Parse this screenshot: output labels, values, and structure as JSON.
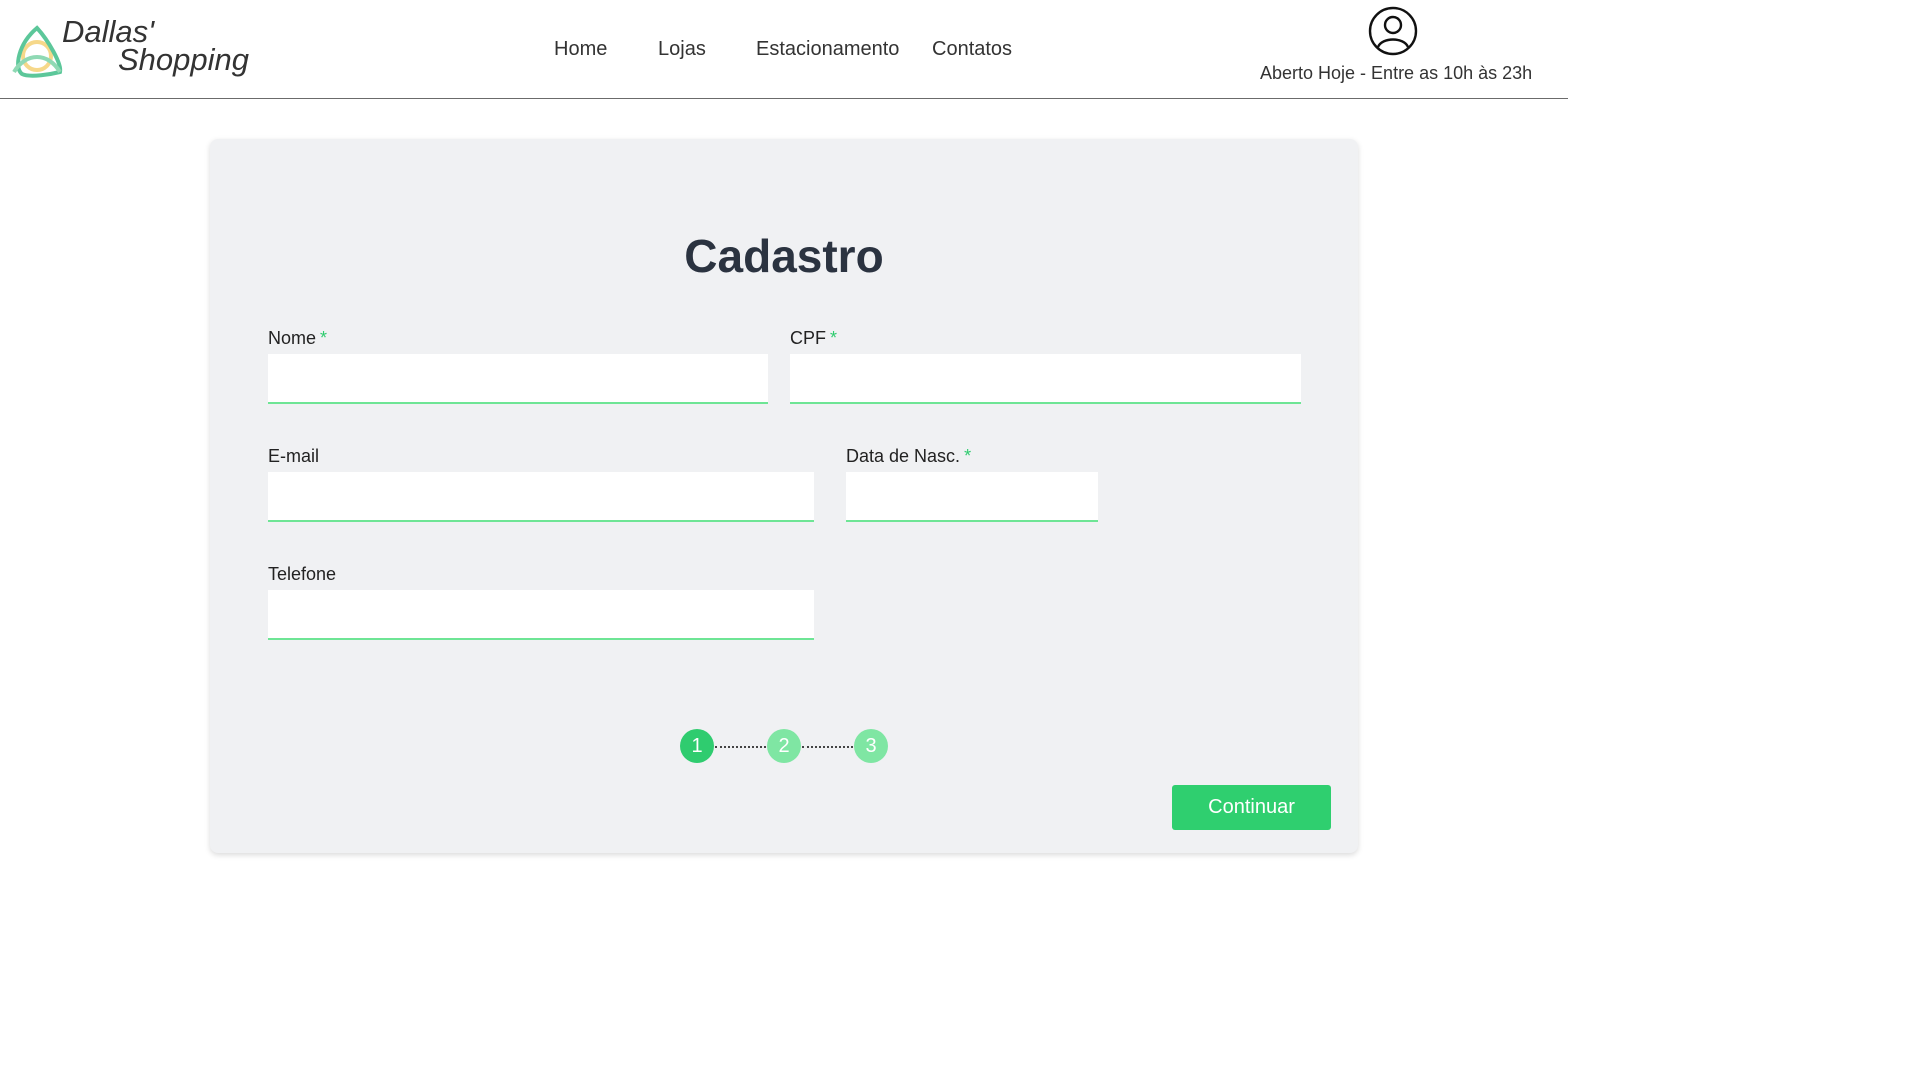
{
  "brand": {
    "line1": "Dallas'",
    "line2": "Shopping",
    "logo_icon": "triquetra-logo-icon"
  },
  "nav": {
    "items": [
      {
        "label": "Home"
      },
      {
        "label": "Lojas"
      },
      {
        "label": "Estacionamento"
      },
      {
        "label": "Contatos"
      }
    ]
  },
  "header": {
    "account_icon": "user-account-icon",
    "hours": "Aberto Hoje - Entre as 10h às 23h"
  },
  "form": {
    "title": "Cadastro",
    "required_mark": "*",
    "fields": {
      "nome": {
        "label": "Nome",
        "value": ""
      },
      "cpf": {
        "label": "CPF",
        "value": ""
      },
      "email": {
        "label": "E-mail",
        "value": ""
      },
      "nasc": {
        "label": "Data de Nasc.",
        "value": ""
      },
      "telefone": {
        "label": "Telefone",
        "value": ""
      }
    },
    "steps": [
      {
        "label": "1",
        "state": "active"
      },
      {
        "label": "2",
        "state": "pending"
      },
      {
        "label": "3",
        "state": "pending"
      }
    ],
    "continue_label": "Continuar"
  },
  "colors": {
    "accent": "#2fcf6f",
    "step_active": "#2fcc6f",
    "step_pending": "#7fe6a3",
    "input_border": "#6ee595",
    "card_bg": "#f0f1f3"
  }
}
